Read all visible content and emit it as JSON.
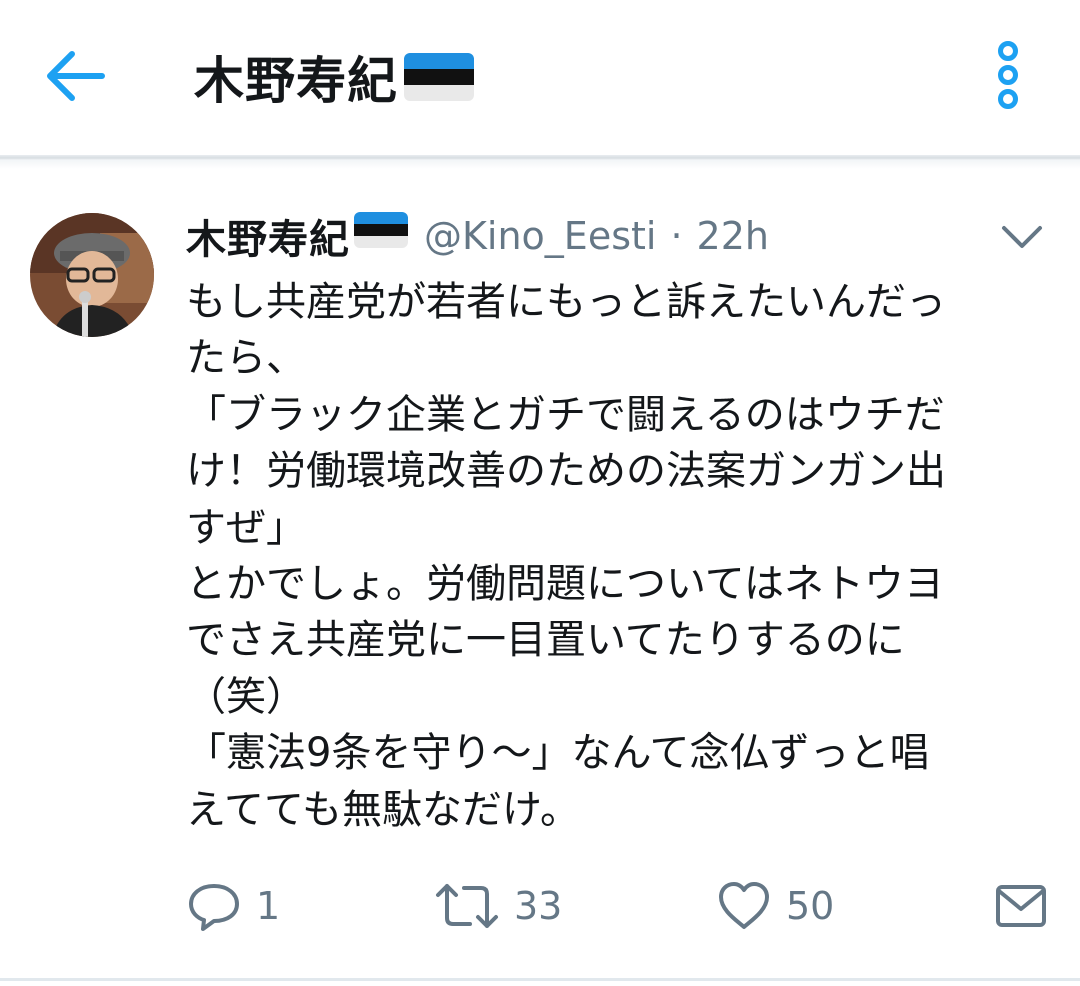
{
  "appbar": {
    "title": "木野寿紀",
    "back_icon": "arrow-left-icon",
    "more_icon": "vertical-dots-icon",
    "accent_color": "#1da1f2"
  },
  "tweet": {
    "author_name": "木野寿紀",
    "flag": "estonia-flag",
    "handle": "@Kino_Eesti",
    "separator": "·",
    "time": "22h",
    "lines": [
      "もし共産党が若者にもっと訴えたいんだっ",
      "たら、",
      "「ブラック企業とガチで闘えるのはウチだ",
      "け！労働環境改善のための法案ガンガン出",
      "すぜ」",
      "とかでしょ。労働問題についてはネトウヨ",
      "でさえ共産党に一目置いてたりするのに",
      "（笑）",
      "「憲法9条を守り～」なんて念仏ずっと唱",
      "えてても無駄なだけ。"
    ]
  },
  "actions": {
    "reply_count": "1",
    "retweet_count": "33",
    "like_count": "50"
  },
  "colors": {
    "text": "#14171a",
    "secondary": "#657786",
    "accent": "#1da1f2"
  }
}
